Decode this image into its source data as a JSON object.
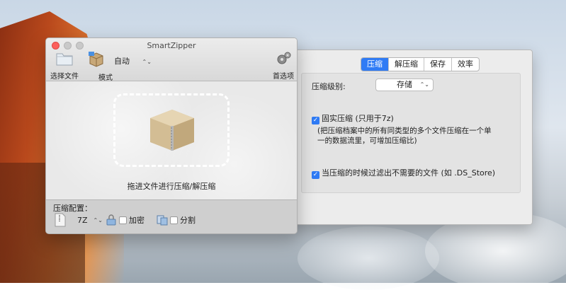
{
  "app": {
    "title": "SmartZipper"
  },
  "toolbar": {
    "choose_file": "选择文件",
    "mode_label": "模式",
    "mode_value": "自动",
    "preferences": "首选项"
  },
  "dropzone": {
    "hint": "拖进文件进行压缩/解压缩"
  },
  "config": {
    "label": "压缩配置：",
    "format": "7Z",
    "encrypt_label": "加密",
    "encrypt_checked": false,
    "split_label": "分割",
    "split_checked": false
  },
  "prefs": {
    "tabs": [
      {
        "label": "压缩",
        "active": true
      },
      {
        "label": "解压缩",
        "active": false
      },
      {
        "label": "保存",
        "active": false
      },
      {
        "label": "效率",
        "active": false
      }
    ],
    "level_label": "压缩级别:",
    "level_value": "存储",
    "solid_label": "固实压缩 (只用于7z)",
    "solid_checked": true,
    "solid_desc": "(把压缩档案中的所有同类型的多个文件压缩在一个单一的数据流里，可增加压缩比)",
    "filter_label": "当压缩的时候过滤出不需要的文件 (如 .DS_Store)",
    "filter_checked": true
  },
  "colors": {
    "accent": "#2f7bf5",
    "close": "#fc605c"
  },
  "icons": [
    "folder-icon",
    "package-mode-icon",
    "gear-icon",
    "zip-file-icon",
    "lock-icon",
    "split-icon",
    "box-icon"
  ]
}
